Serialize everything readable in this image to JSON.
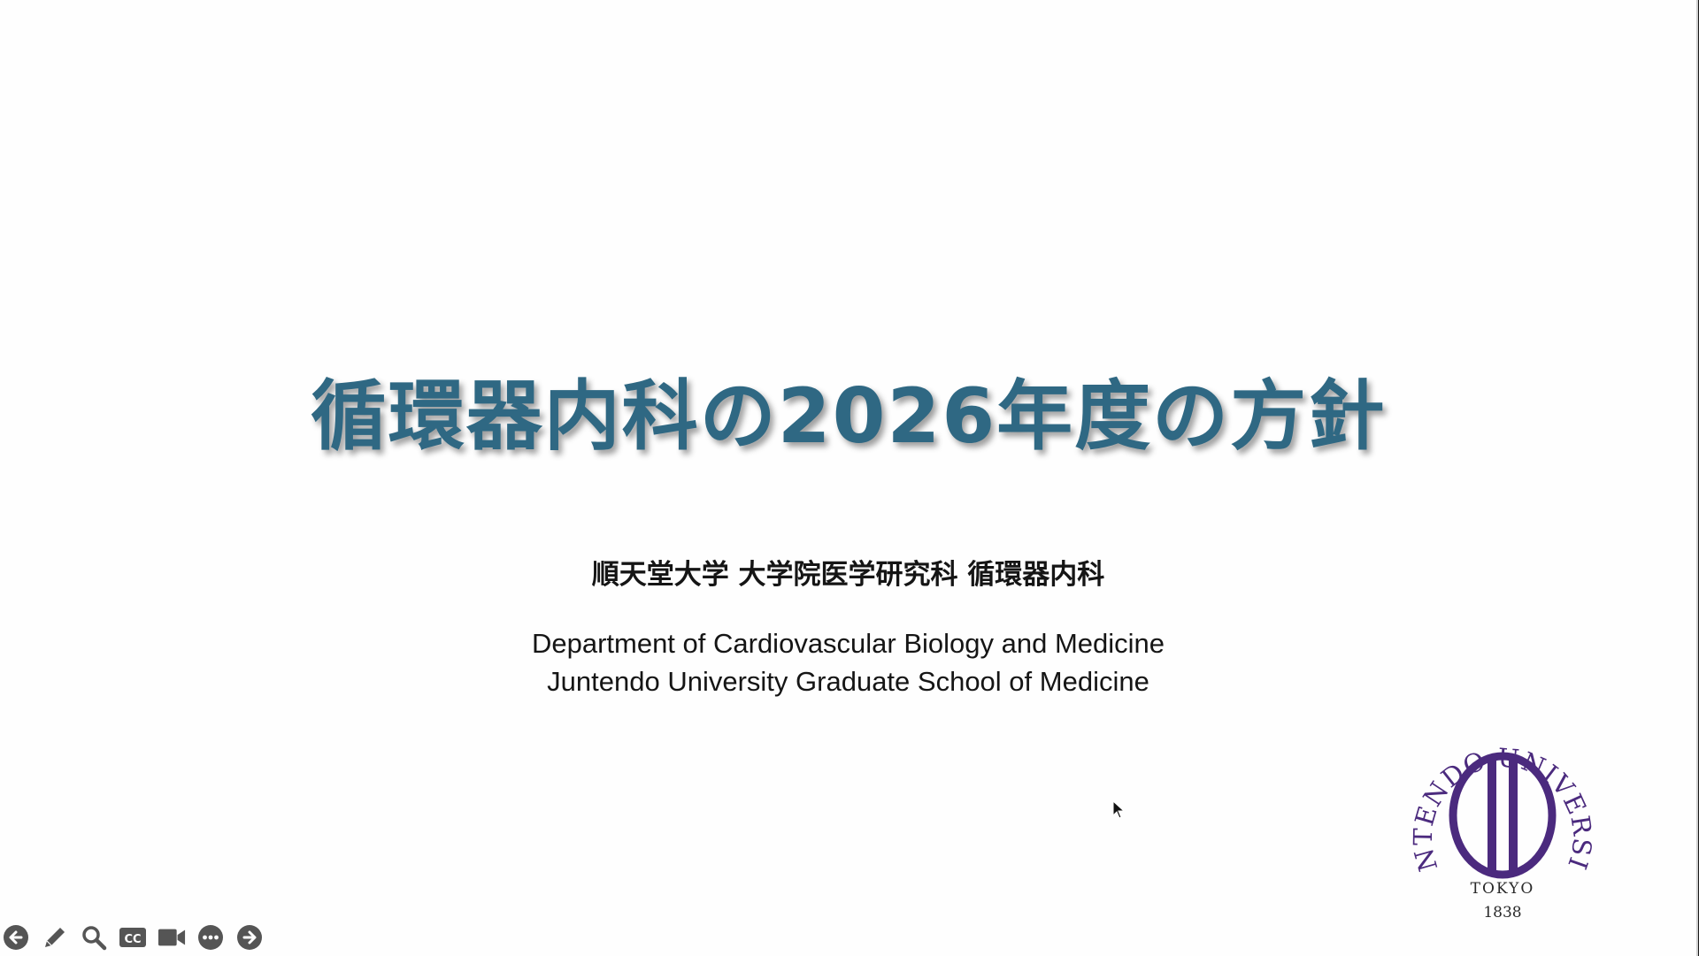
{
  "slide": {
    "title": "循環器内科の2026年度の方針",
    "affiliation_jp": "順天堂大学 大学院医学研究科 循環器内科",
    "affiliation_en_line1": "Department of Cardiovascular Biology and Medicine",
    "affiliation_en_line2": "Juntendo University Graduate School of Medicine"
  },
  "seal": {
    "ring_text": "JUNTENDO UNIVERSITY",
    "city": "TOKYO",
    "year": "1838",
    "color": "#4b2a7e"
  },
  "toolbar": {
    "items": [
      {
        "icon": "arrow-left-circle-icon"
      },
      {
        "icon": "pen-icon"
      },
      {
        "icon": "magnifier-icon"
      },
      {
        "icon": "cc-icon",
        "label": "CC"
      },
      {
        "icon": "video-camera-icon"
      },
      {
        "icon": "more-options-icon"
      },
      {
        "icon": "arrow-right-circle-icon"
      }
    ],
    "color": "#555555"
  },
  "colors": {
    "title": "#2f6883",
    "text": "#151515",
    "background": "#fefefe"
  }
}
